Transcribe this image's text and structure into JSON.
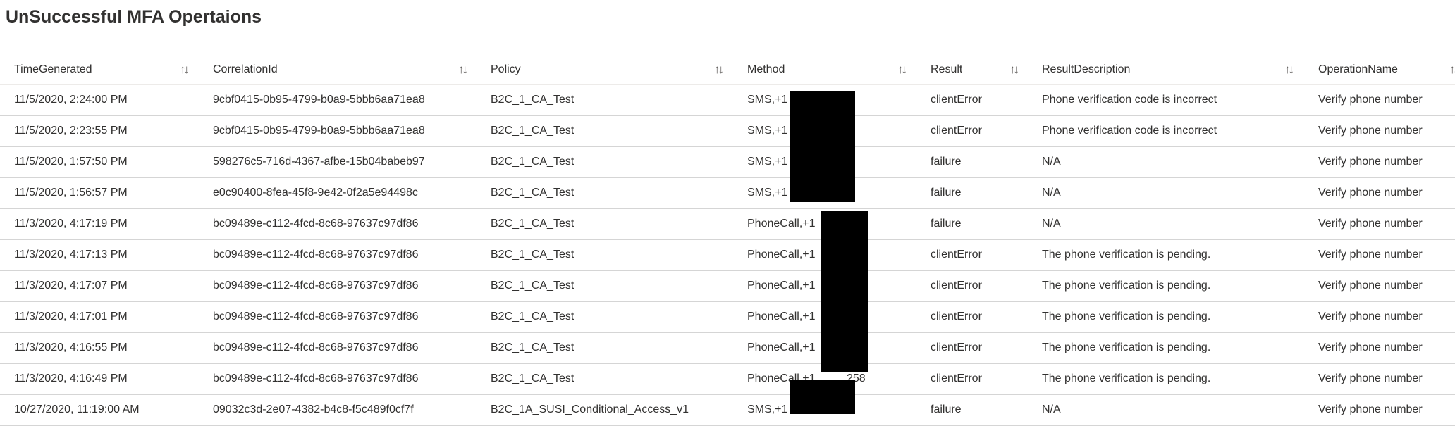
{
  "title": "UnSuccessful MFA Opertaions",
  "columns": [
    "TimeGenerated",
    "CorrelationId",
    "Policy",
    "Method",
    "Result",
    "ResultDescription",
    "OperationName"
  ],
  "sort_glyph": "↑↓",
  "rows": [
    [
      "11/5/2020, 2:24:00 PM",
      "9cbf0415-0b95-4799-b0a9-5bbb6aa71ea8",
      "B2C_1_CA_Test",
      "SMS,+1",
      "clientError",
      "Phone verification code is incorrect",
      "Verify phone number"
    ],
    [
      "11/5/2020, 2:23:55 PM",
      "9cbf0415-0b95-4799-b0a9-5bbb6aa71ea8",
      "B2C_1_CA_Test",
      "SMS,+1",
      "clientError",
      "Phone verification code is incorrect",
      "Verify phone number"
    ],
    [
      "11/5/2020, 1:57:50 PM",
      "598276c5-716d-4367-afbe-15b04babeb97",
      "B2C_1_CA_Test",
      "SMS,+1",
      "failure",
      "N/A",
      "Verify phone number"
    ],
    [
      "11/5/2020, 1:56:57 PM",
      "e0c90400-8fea-45f8-9e42-0f2a5e94498c",
      "B2C_1_CA_Test",
      "SMS,+1",
      "failure",
      "N/A",
      "Verify phone number"
    ],
    [
      "11/3/2020, 4:17:19 PM",
      "bc09489e-c112-4fcd-8c68-97637c97df86",
      "B2C_1_CA_Test",
      "PhoneCall,+1          258",
      "failure",
      "N/A",
      "Verify phone number"
    ],
    [
      "11/3/2020, 4:17:13 PM",
      "bc09489e-c112-4fcd-8c68-97637c97df86",
      "B2C_1_CA_Test",
      "PhoneCall,+1          258",
      "clientError",
      "The phone verification is pending.",
      "Verify phone number"
    ],
    [
      "11/3/2020, 4:17:07 PM",
      "bc09489e-c112-4fcd-8c68-97637c97df86",
      "B2C_1_CA_Test",
      "PhoneCall,+1          258",
      "clientError",
      "The phone verification is pending.",
      "Verify phone number"
    ],
    [
      "11/3/2020, 4:17:01 PM",
      "bc09489e-c112-4fcd-8c68-97637c97df86",
      "B2C_1_CA_Test",
      "PhoneCall,+1          258",
      "clientError",
      "The phone verification is pending.",
      "Verify phone number"
    ],
    [
      "11/3/2020, 4:16:55 PM",
      "bc09489e-c112-4fcd-8c68-97637c97df86",
      "B2C_1_CA_Test",
      "PhoneCall,+1          258",
      "clientError",
      "The phone verification is pending.",
      "Verify phone number"
    ],
    [
      "11/3/2020, 4:16:49 PM",
      "bc09489e-c112-4fcd-8c68-97637c97df86",
      "B2C_1_CA_Test",
      "PhoneCall,+1          258",
      "clientError",
      "The phone verification is pending.",
      "Verify phone number"
    ],
    [
      "10/27/2020, 11:19:00 AM",
      "09032c3d-2e07-4382-b4c8-f5c489f0cf7f",
      "B2C_1A_SUSI_Conditional_Access_v1",
      "SMS,+1",
      "failure",
      "N/A",
      "Verify phone number"
    ]
  ]
}
